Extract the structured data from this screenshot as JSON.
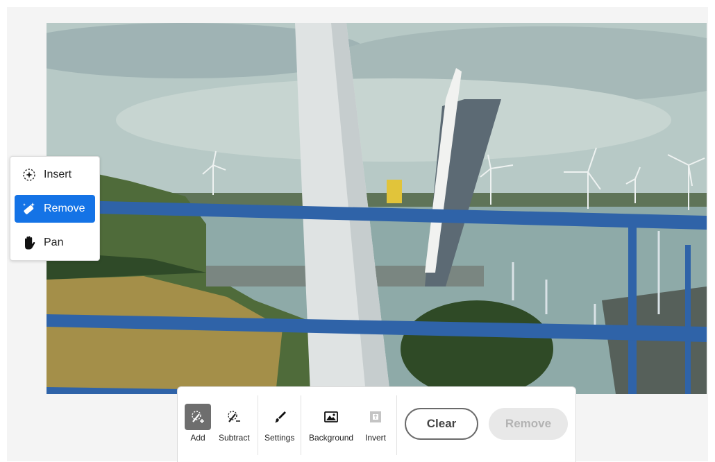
{
  "side_menu": {
    "items": [
      {
        "label": "Insert",
        "icon": "sparkle-lasso-icon",
        "active": false
      },
      {
        "label": "Remove",
        "icon": "eraser-sparkle-icon",
        "active": true
      },
      {
        "label": "Pan",
        "icon": "hand-icon",
        "active": false
      }
    ]
  },
  "toolbar": {
    "tools": [
      {
        "label": "Add",
        "icon": "add-selection-icon",
        "active": true
      },
      {
        "label": "Subtract",
        "icon": "subtract-selection-icon",
        "active": false
      },
      {
        "label": "Settings",
        "icon": "brush-icon",
        "active": false
      },
      {
        "label": "Background",
        "icon": "image-icon",
        "active": false
      },
      {
        "label": "Invert",
        "icon": "invert-icon",
        "active": false,
        "disabled": true
      }
    ],
    "clear_label": "Clear",
    "remove_label": "Remove",
    "remove_disabled": true
  },
  "colors": {
    "accent": "#1473e6",
    "active_tool": "#6e6e6e",
    "railing": "#2f63a8"
  }
}
